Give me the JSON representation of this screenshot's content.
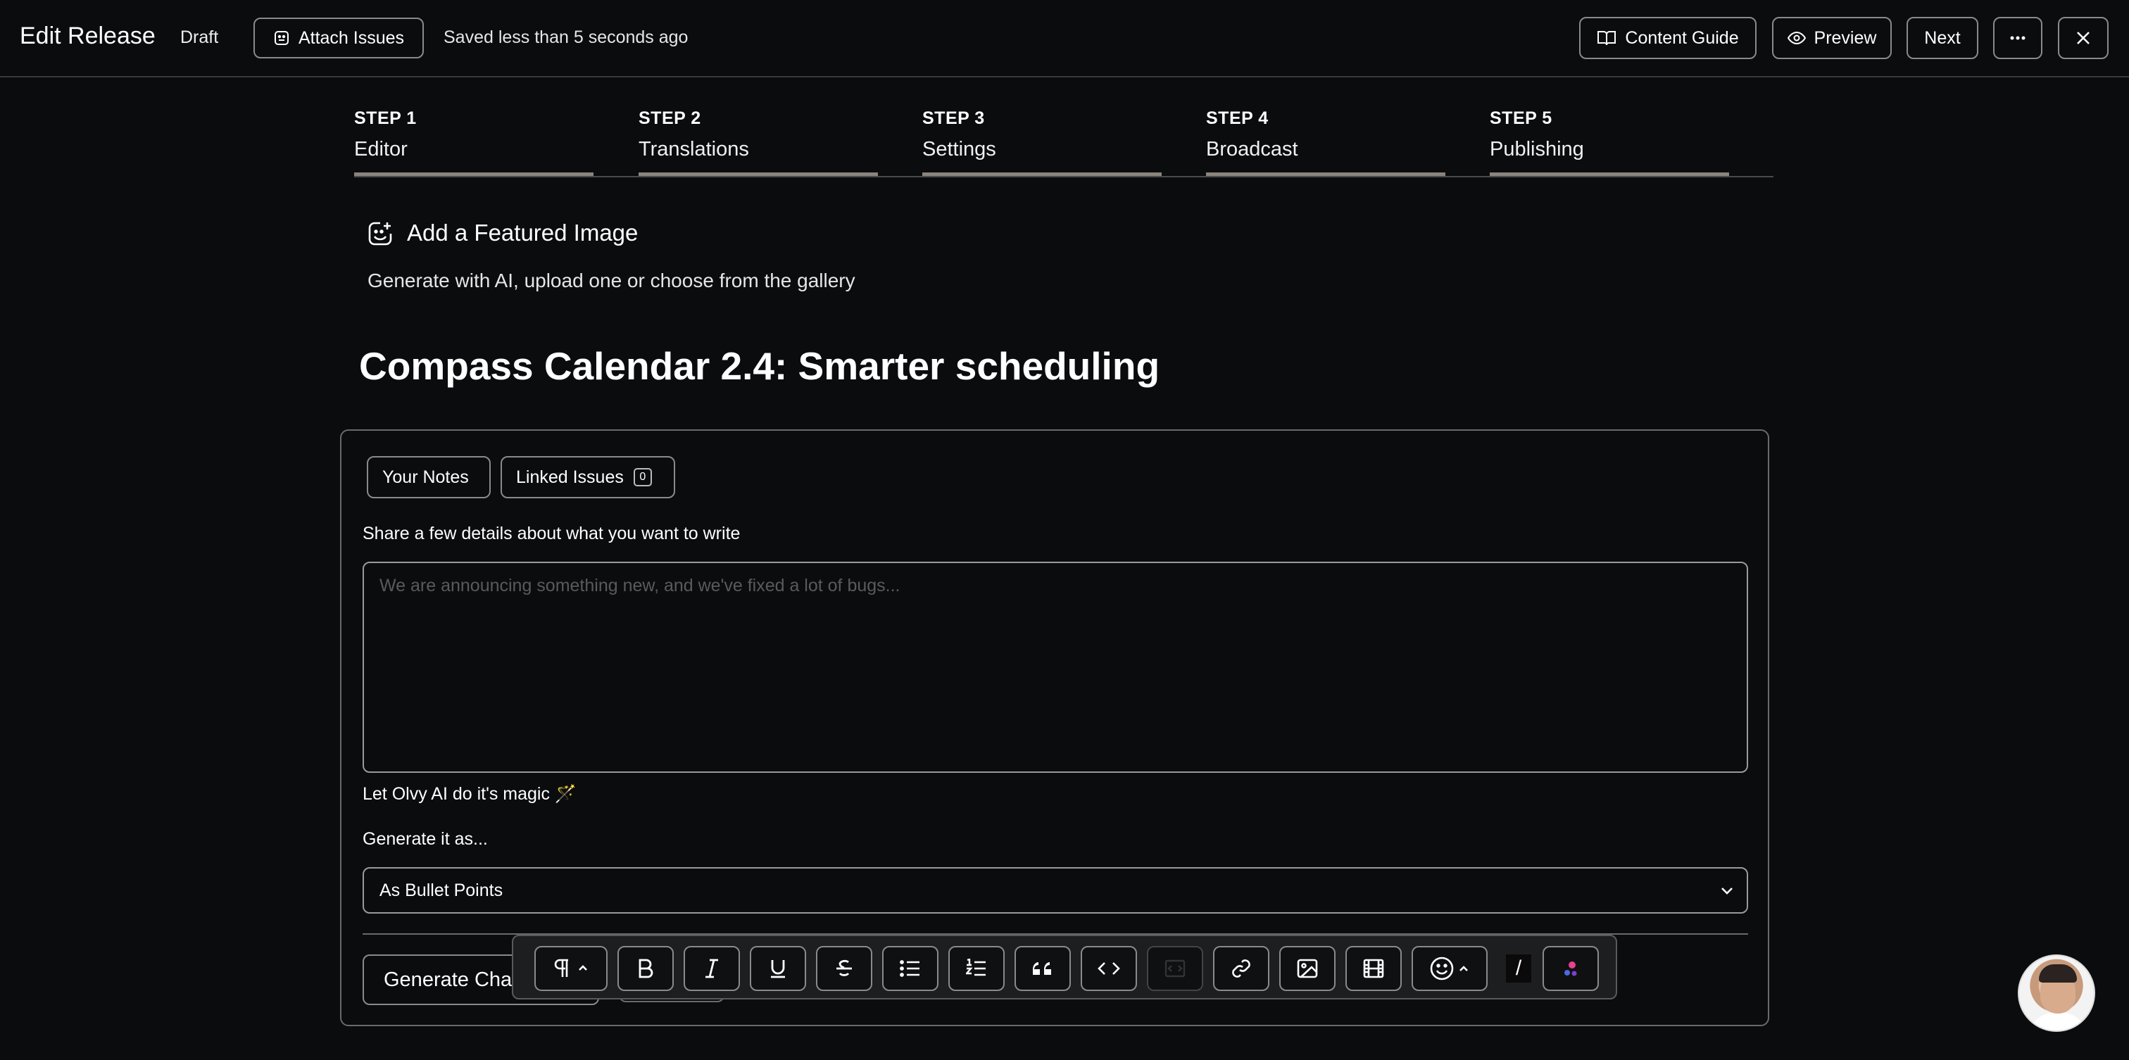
{
  "header": {
    "title": "Edit Release",
    "status": "Draft",
    "attach_issues": "Attach Issues",
    "saved": "Saved less than 5 seconds ago",
    "content_guide": "Content Guide",
    "preview": "Preview",
    "next": "Next"
  },
  "steps": [
    {
      "num": "STEP 1",
      "label": "Editor"
    },
    {
      "num": "STEP 2",
      "label": "Translations"
    },
    {
      "num": "STEP 3",
      "label": "Settings"
    },
    {
      "num": "STEP 4",
      "label": "Broadcast"
    },
    {
      "num": "STEP 5",
      "label": "Publishing"
    }
  ],
  "featured": {
    "title": "Add a Featured Image",
    "subtitle": "Generate with AI, upload one or choose from the gallery"
  },
  "headline": "Compass Calendar 2.4: Smarter scheduling",
  "composer": {
    "tabs": {
      "notes": "Your Notes",
      "linked": "Linked Issues",
      "linked_count": "0"
    },
    "prompt_label": "Share a few details about what you want to write",
    "prompt_placeholder": "We are announcing something new, and we've fixed a lot of bugs...",
    "magic": "Let Olvy AI do it's magic 🪄",
    "generate_as_label": "Generate it as...",
    "generate_as_value": "As Bullet Points",
    "generate_button": "Generate Changelog"
  },
  "toolbar": {
    "icons": [
      "paragraph-icon",
      "bold-icon",
      "italic-icon",
      "underline-icon",
      "strikethrough-icon",
      "bullet-list-icon",
      "numbered-list-icon",
      "quote-icon",
      "code-icon",
      "code-block-icon",
      "link-icon",
      "image-icon",
      "video-icon",
      "emoji-icon",
      "slash-command-icon",
      "ai-icon"
    ],
    "slash": "/"
  },
  "colors": {
    "background": "#0b0c0e",
    "border": "#8a8a8a",
    "step_bar": "#8b847d"
  }
}
